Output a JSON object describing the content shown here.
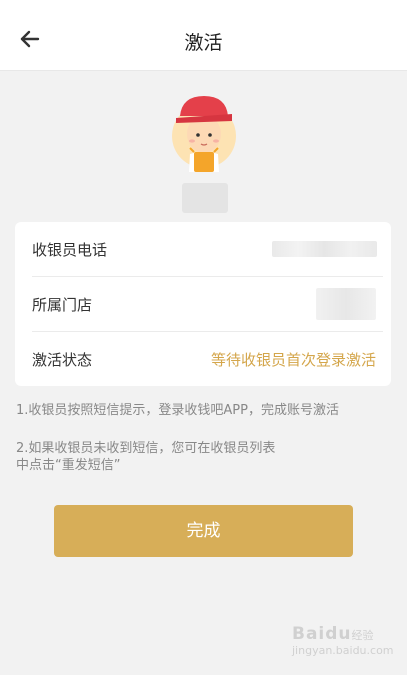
{
  "header": {
    "title": "激活"
  },
  "info_rows": [
    {
      "label": "收银员电话"
    },
    {
      "label": "所属门店"
    },
    {
      "label": "激活状态",
      "value": "等待收银员首次登录激活"
    }
  ],
  "tips": [
    "1.收银员按照短信提示，登录收钱吧APP，完成账号激活",
    "2.如果收银员未收到短信，您可在收银员列表",
    "中点击“重发短信”"
  ],
  "actions": {
    "done_label": "完成"
  },
  "watermark": {
    "brand": "Baidu",
    "suffix": "经验",
    "url": "jingyan.baidu.com"
  },
  "colors": {
    "accent": "#d7ae58",
    "status_text": "#d4a64b",
    "background": "#f2f2f2"
  },
  "icons": {
    "back": "arrow-left-icon",
    "avatar": "cashier-avatar-icon"
  }
}
